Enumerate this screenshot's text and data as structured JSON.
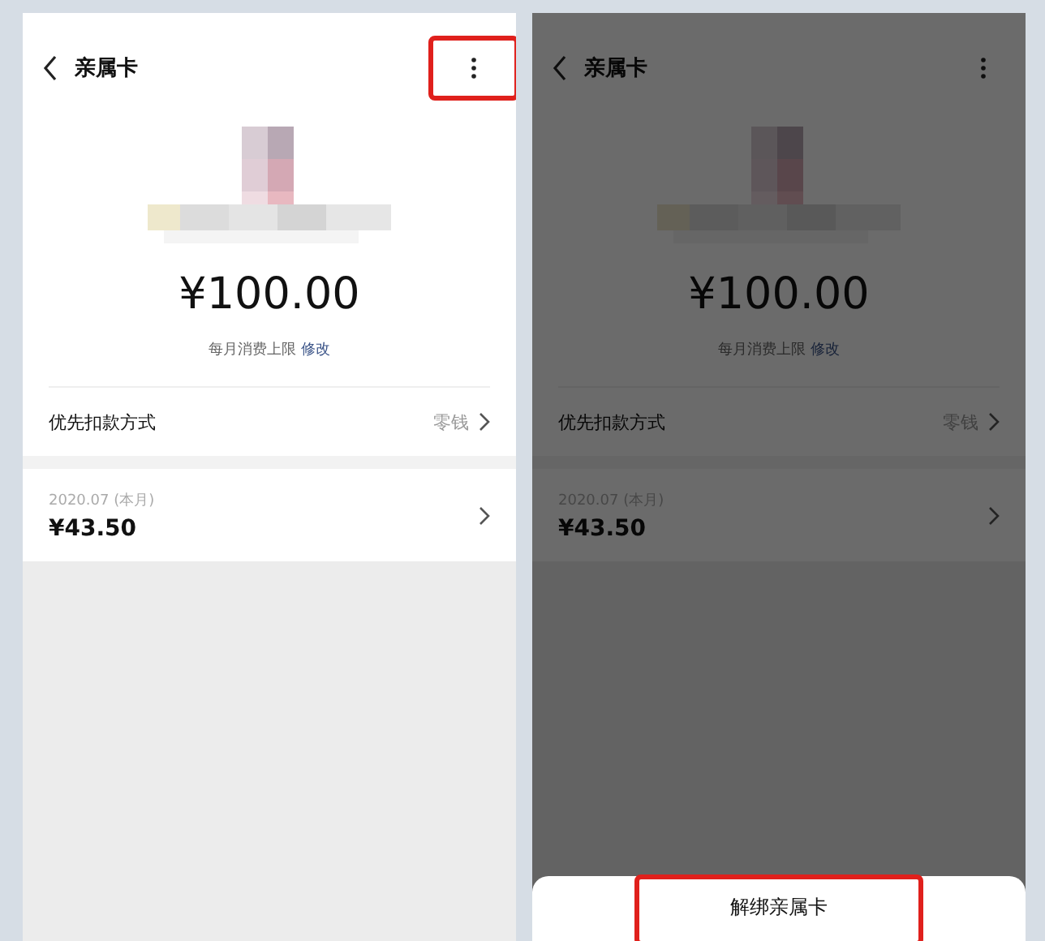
{
  "screens": [
    {
      "title": "亲属卡",
      "menu_highlighted": true,
      "limit_amount": "¥100.00",
      "limit_label": "每月消费上限",
      "limit_link": "修改",
      "pay_label": "优先扣款方式",
      "pay_value": "零钱",
      "bill_month": "2020.07 (本月)",
      "bill_amount": "¥43.50"
    },
    {
      "title": "亲属卡",
      "menu_highlighted": false,
      "dimmed": true,
      "limit_amount": "¥100.00",
      "limit_label": "每月消费上限",
      "limit_link": "修改",
      "pay_label": "优先扣款方式",
      "pay_value": "零钱",
      "bill_month": "2020.07 (本月)",
      "bill_amount": "¥43.50",
      "action_sheet": {
        "option": "解绑亲属卡",
        "highlighted": true
      }
    }
  ]
}
